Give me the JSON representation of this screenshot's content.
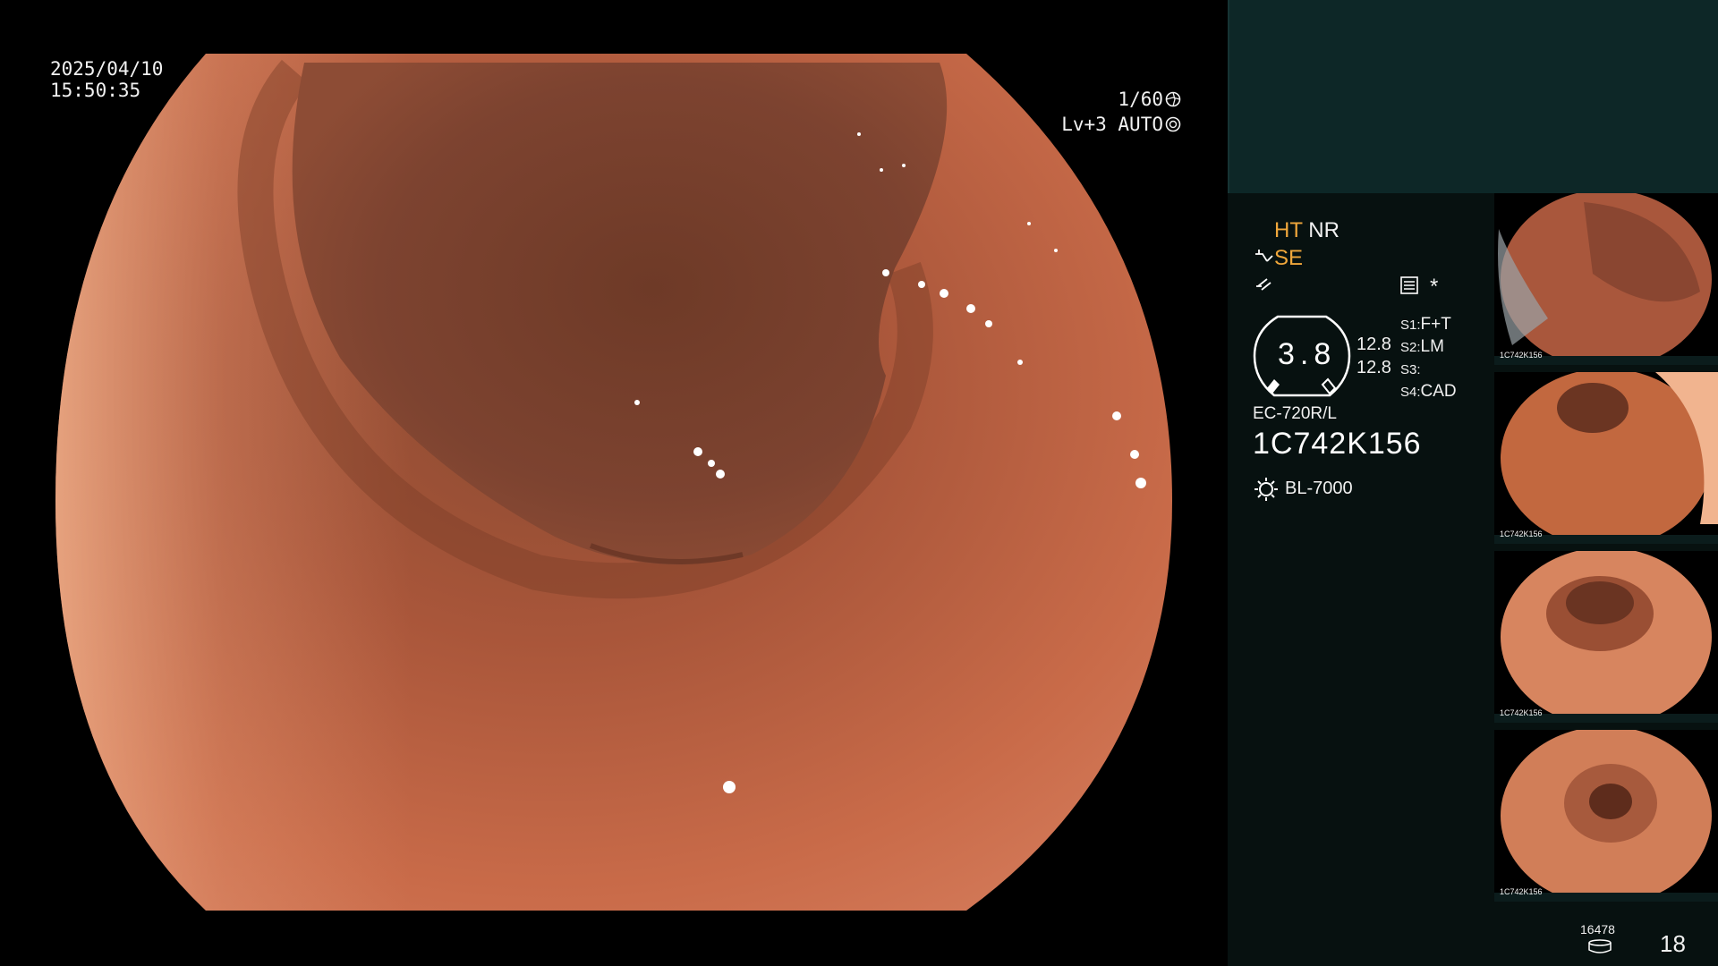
{
  "overlay": {
    "date": "2025/04/10",
    "time": "15:50:35",
    "shutter": "1/60",
    "level": "Lv+3 AUTO"
  },
  "panel": {
    "mode_ht": "HT",
    "mode_nr": "NR",
    "mode_se": "SE",
    "gauge_value": "3.8",
    "value_a": "12.8",
    "value_b": "12.8",
    "s1_label": "S1:",
    "s1_value": "F+T",
    "s2_label": "S2:",
    "s2_value": "LM",
    "s3_label": "S3:",
    "s3_value": "",
    "s4_label": "S4:",
    "s4_value": "CAD",
    "scope_model": "EC-720R/L",
    "serial": "1C742K156",
    "light_source": "BL-7000",
    "asterisk": "*"
  },
  "thumbnails": [
    {
      "label": "1C742K156"
    },
    {
      "label": "1C742K156"
    },
    {
      "label": "1C742K156"
    },
    {
      "label": "1C742K156"
    }
  ],
  "footer": {
    "storage_count": "16478",
    "image_count": "18"
  },
  "icons": {
    "shutter": "aperture-icon",
    "auto": "auto-iris-icon",
    "scope_tool": "scope-tool-icon",
    "lightning": "lightning-icon",
    "settings": "settings-grid-icon",
    "light": "light-bulb-icon",
    "storage": "storage-drum-icon"
  },
  "colors": {
    "panel_bg": "#071110",
    "header_bg": "#0d2727",
    "mode_accent": "#f0a73b"
  }
}
